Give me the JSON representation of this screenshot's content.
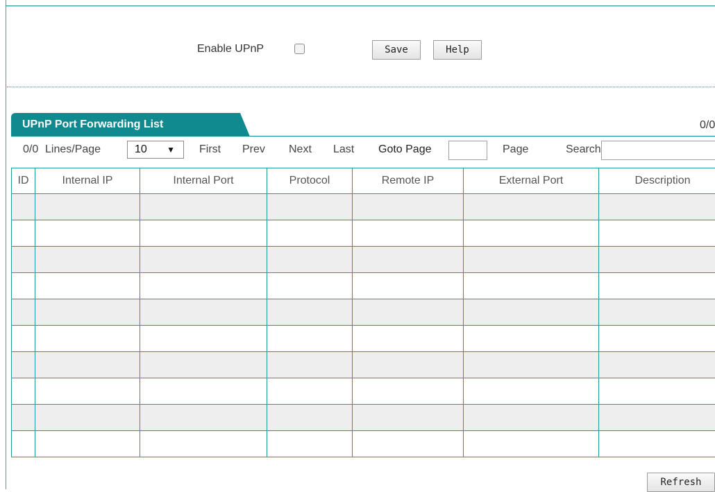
{
  "upnp": {
    "label": "Enable UPnP",
    "enabled": false
  },
  "buttons": {
    "save": "Save",
    "help": "Help",
    "refresh": "Refresh"
  },
  "list": {
    "title": "UPnP Port Forwarding List",
    "count_right": "0/0",
    "count_left": "0/0",
    "lines_per_page_label": "Lines/Page",
    "lines_per_page_value": "10",
    "lines_per_page_arrow": "▼",
    "first": "First",
    "prev": "Prev",
    "next": "Next",
    "last": "Last",
    "goto_label": "Goto Page",
    "page_label": "Page",
    "search_label": "Search",
    "goto_value": "",
    "search_value": ""
  },
  "table": {
    "columns": [
      "ID",
      "Internal IP",
      "Internal Port",
      "Protocol",
      "Remote IP",
      "External Port",
      "Description"
    ],
    "row_count": 10
  },
  "colors": {
    "accent": "#10898f",
    "border": "#1a9a9a",
    "row_alt": "#eeeeee"
  }
}
